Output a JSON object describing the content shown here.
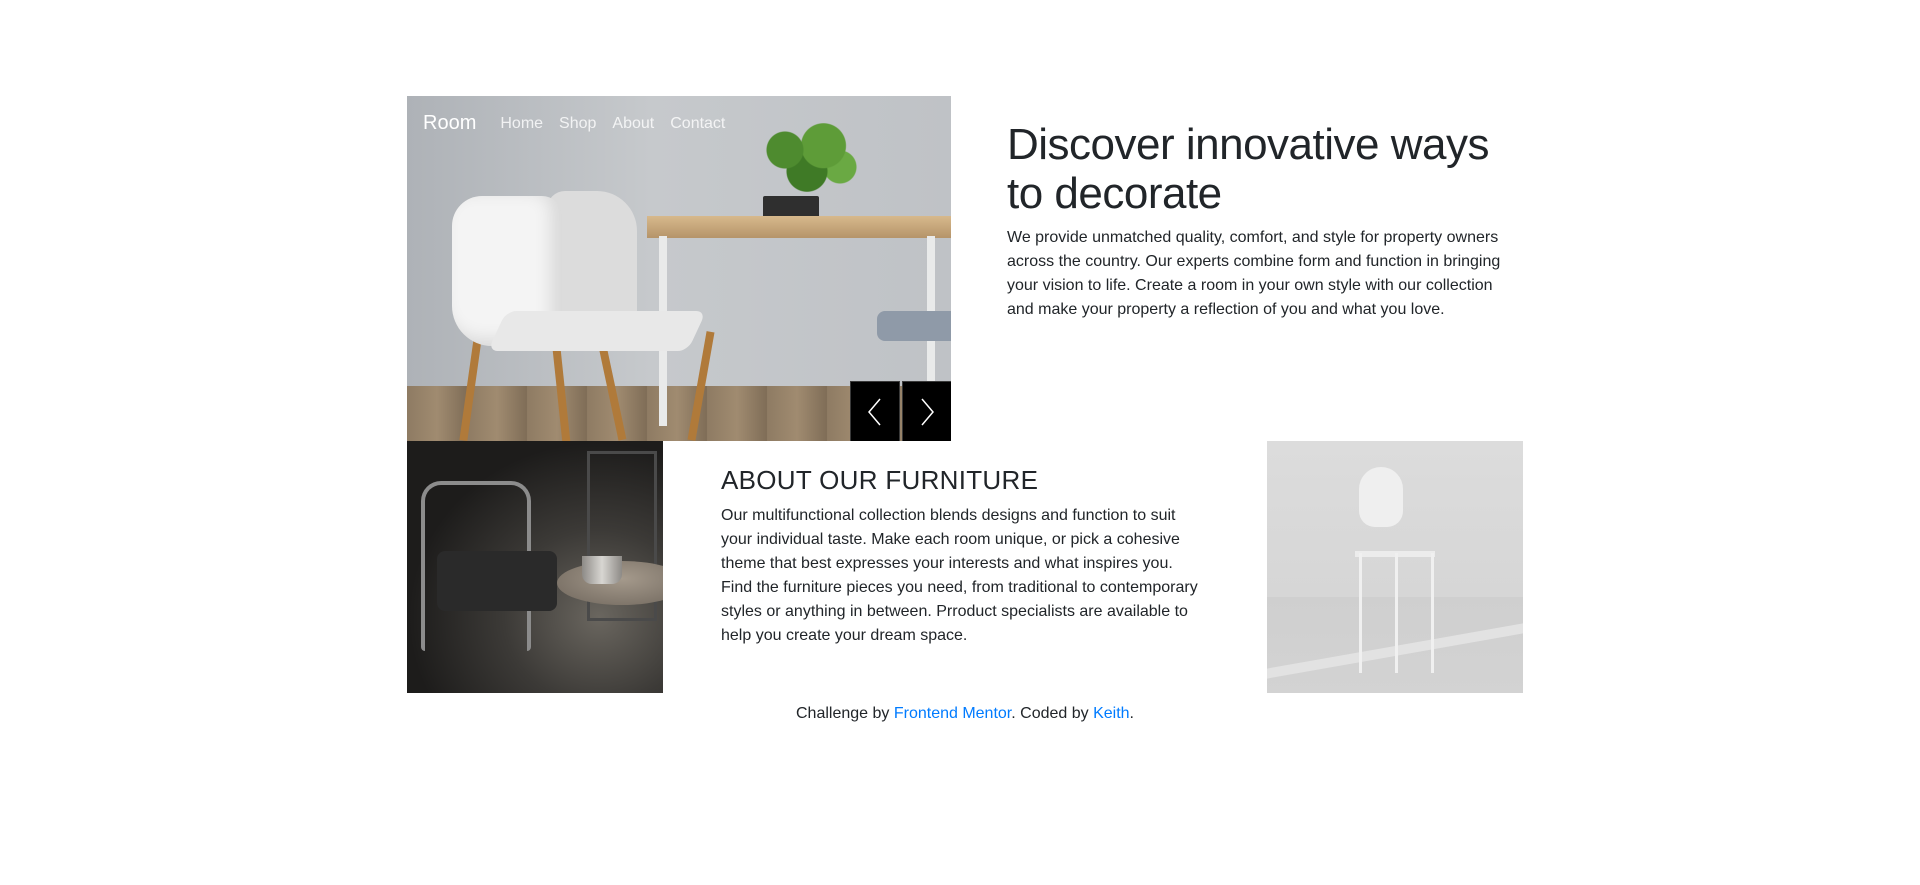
{
  "nav": {
    "brand": "Room",
    "links": [
      "Home",
      "Shop",
      "About",
      "Contact"
    ]
  },
  "carousel": {
    "prev_icon": "chevron-left-icon",
    "next_icon": "chevron-right-icon"
  },
  "intro": {
    "title": "Discover innovative ways to decorate",
    "body": "We provide unmatched quality, comfort, and style for property owners across the country. Our experts combine form and function in bringing your vision to life. Create a room in your own style with our collection and make your property a reflection of you and what you love."
  },
  "about": {
    "title": "ABOUT OUR FURNITURE",
    "body": "Our multifunctional collection blends designs and function to suit your individual taste. Make each room unique, or pick a cohesive theme that best expresses your interests and what inspires you. Find the furniture pieces you need, from traditional to contemporary styles or anything in between. Prroduct specialists are available to help you create your dream space."
  },
  "footer": {
    "prefix": "Challenge by ",
    "link1": "Frontend Mentor",
    "middle": ". Coded by ",
    "link2": "Keith",
    "suffix": "."
  },
  "colors": {
    "link": "#007bff",
    "text": "#212529",
    "control_bg": "#000000"
  }
}
